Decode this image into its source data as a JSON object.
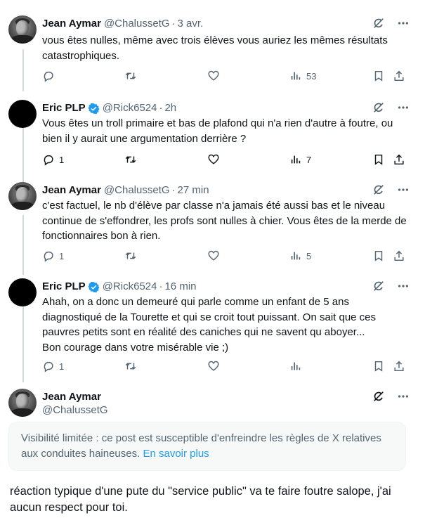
{
  "tweets": [
    {
      "name": "Jean Aymar",
      "handle": "@ChalussetG",
      "time": "3 avr.",
      "text": "vous êtes nulles, même avec trois élèves vous auriez les mêmes résultats catastrophiques.",
      "replies": "",
      "views": "53"
    },
    {
      "name": "Eric PLP",
      "handle": "@Rick6524",
      "time": "2h",
      "text": "Vous êtes un troll primaire et bas de plafond qui n'a rien d'autre à foutre, ou bien il y aurait une argumentation derrière ?",
      "replies": "1",
      "views": "7"
    },
    {
      "name": "Jean Aymar",
      "handle": "@ChalussetG",
      "time": "27 min",
      "text": "c'est factuel, le nb d'élève par classe n'a jamais été aussi bas et le niveau continue de s'effondrer, les profs sont nulles à chier. Vous êtes de la merde de fonctionnaires bon à rien.",
      "replies": "1",
      "views": "5"
    },
    {
      "name": "Eric PLP",
      "handle": "@Rick6524",
      "time": "16 min",
      "text_lines": [
        "Ahah, on a donc un demeuré qui parle comme un enfant de 5 ans",
        "diagnostiqué de la Tourette et qui se croit tout puissant. On sait que ces",
        "pauvres petits sont en réalité des caniches qui ne savent qu aboyer...",
        "Bon courage dans votre misérable vie ;)"
      ],
      "replies": "1",
      "views": ""
    }
  ],
  "last_tweet": {
    "name": "Jean Aymar",
    "handle": "@ChalussetG"
  },
  "notice": {
    "text": "Visibilité limitée : ce post est susceptible d'enfreindre les règles de X relatives aux conduites haineuses.",
    "link": "En savoir plus"
  },
  "bottom_text": "réaction typique d'une pute du \"service public\" va te faire foutre salope, j'ai aucun respect pour toi.",
  "icons": [
    "grok-icon",
    "more-icon",
    "reply-icon",
    "retweet-icon",
    "like-icon",
    "views-icon",
    "bookmark-icon",
    "share-icon",
    "verified-icon"
  ],
  "colors": {
    "verified": "#1d9bf0",
    "link": "#1d9bf0",
    "secondary_text": "#536471",
    "thread_line": "#cfd9de",
    "notice_bg": "#f7f9f9"
  }
}
